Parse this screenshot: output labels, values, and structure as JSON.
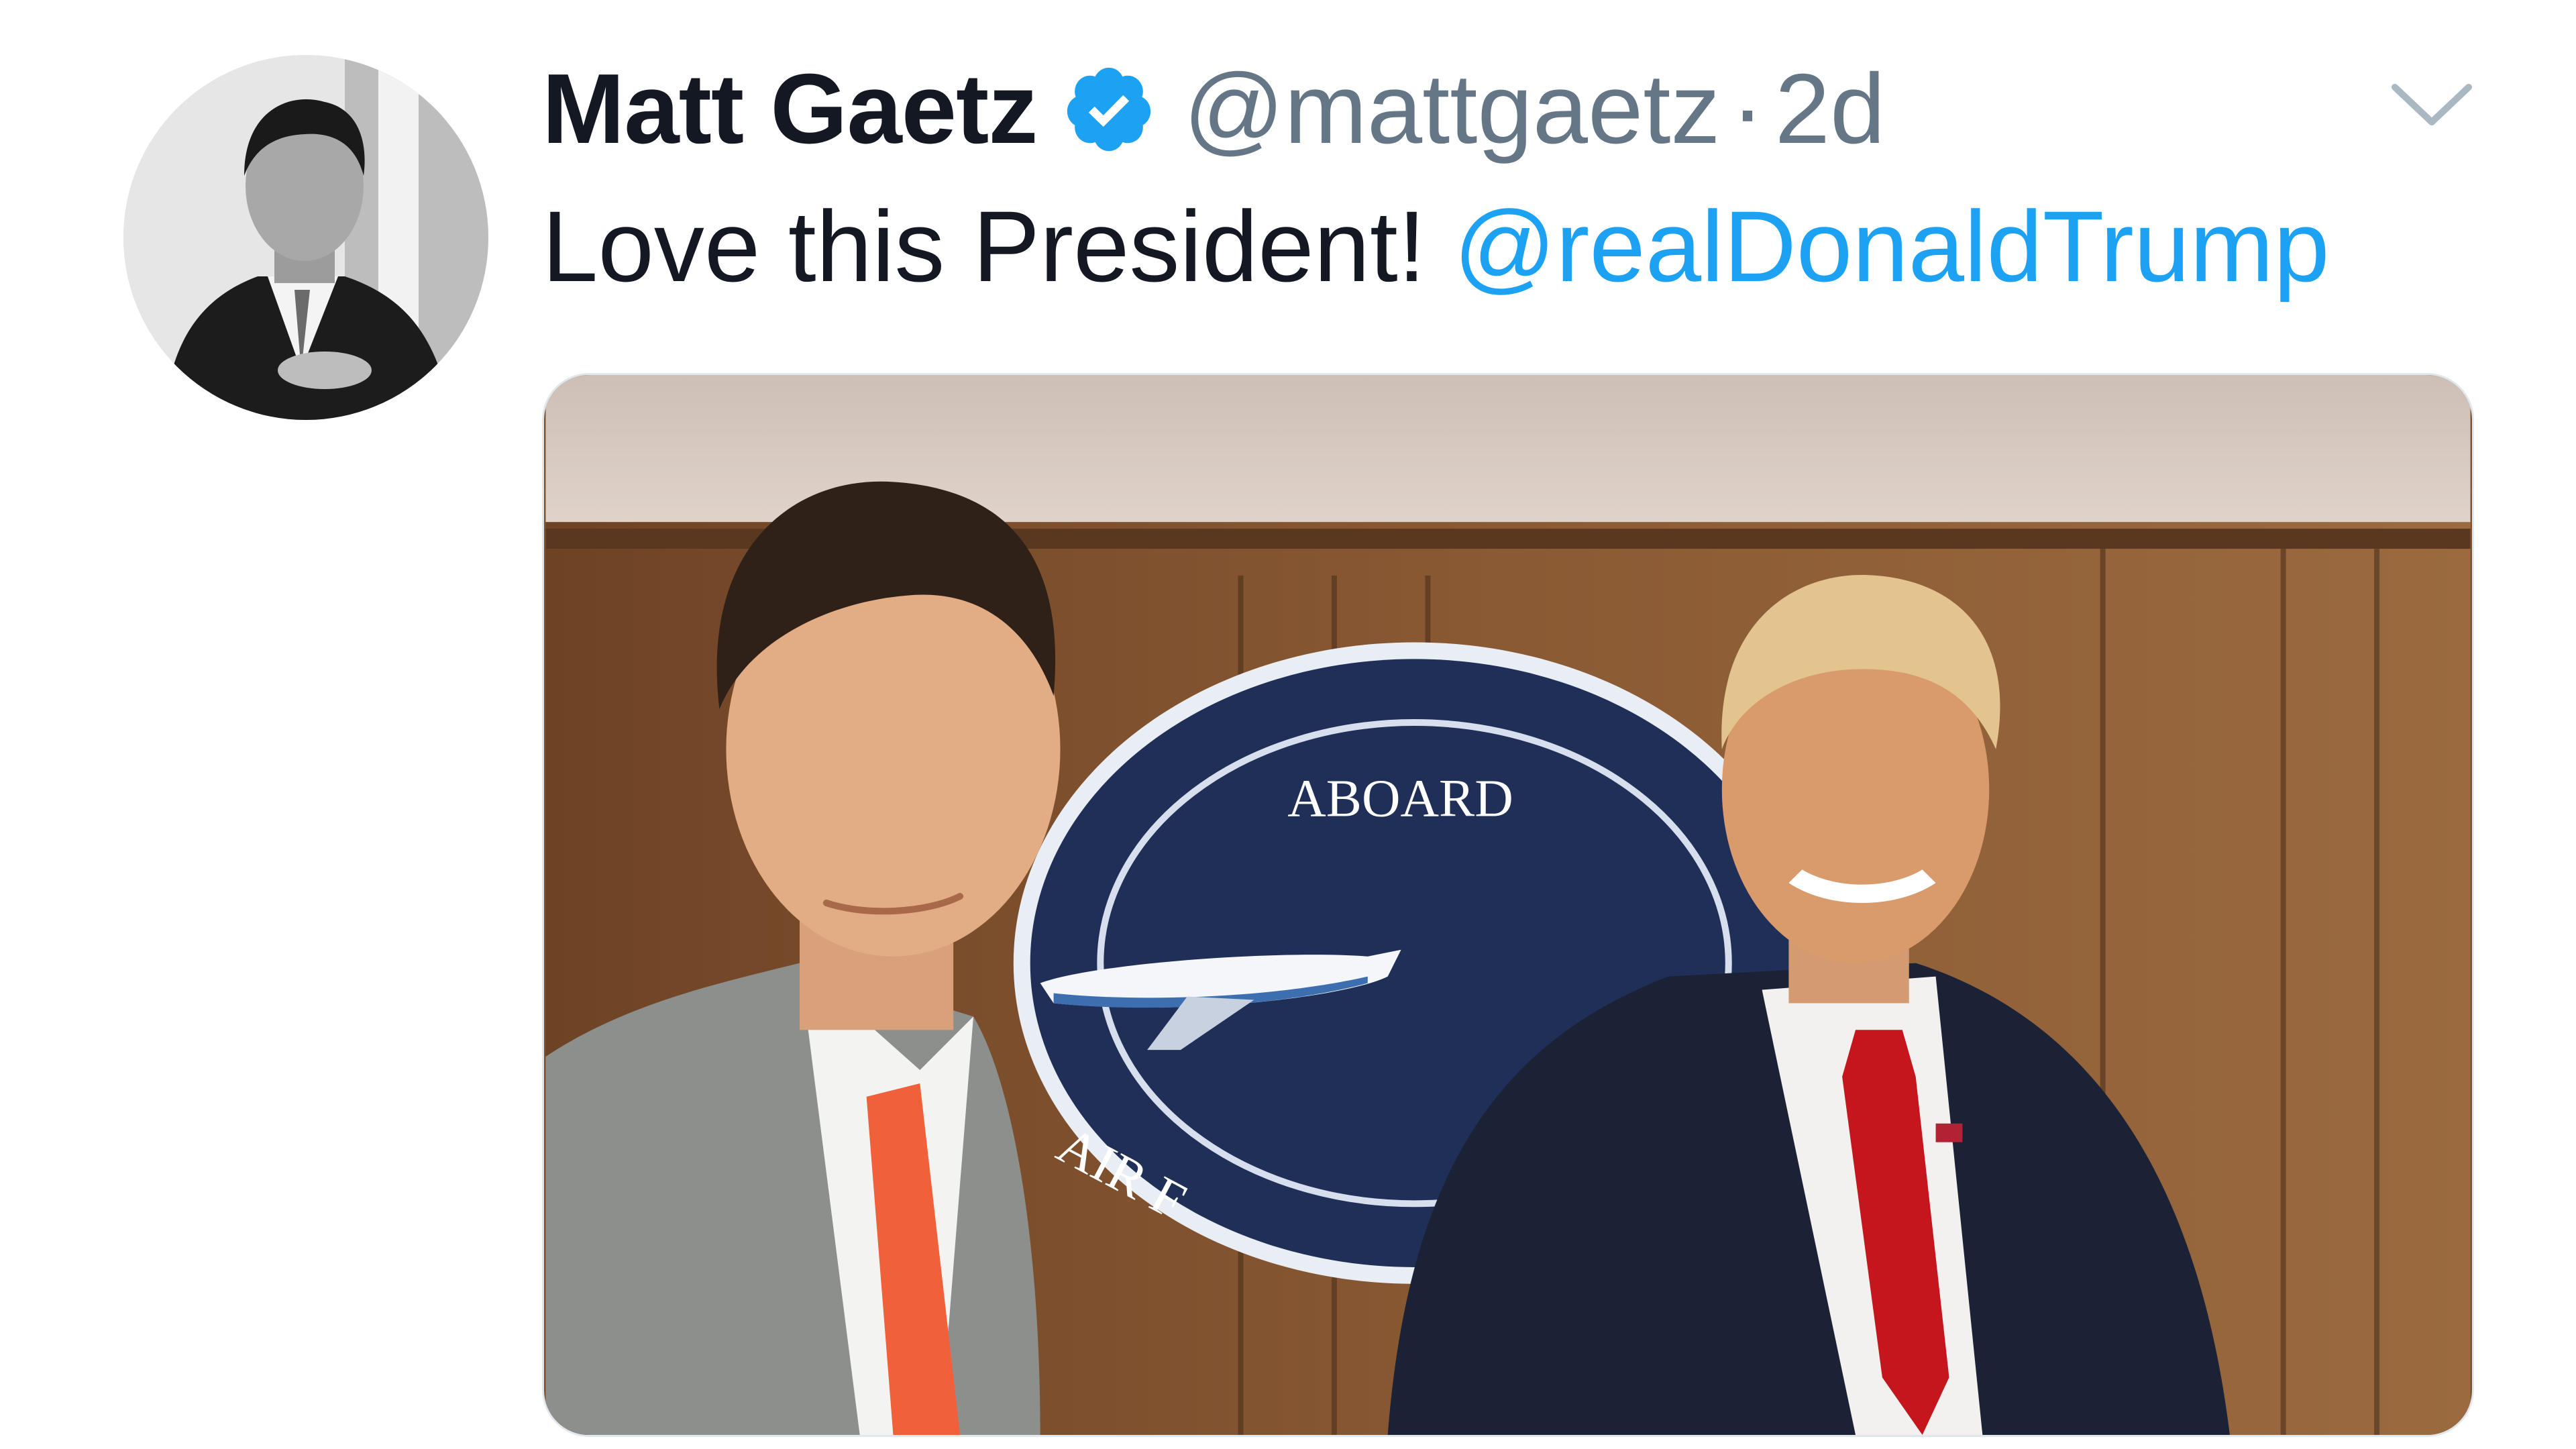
{
  "tweet": {
    "author_name": "Matt Gaetz",
    "handle": "@mattgaetz",
    "separator": "·",
    "time_ago": "2d",
    "text": "Love this President!",
    "mention": "@realDonaldTrump",
    "verified": true,
    "photo": {
      "seal_text_top": "ABOARD",
      "seal_text_bottom": "AIR F"
    }
  },
  "colors": {
    "text": "#141823",
    "secondary": "#657786",
    "link": "#1da1f2",
    "verified": "#1da1f2"
  },
  "icons": {
    "verified": "verified-badge-icon",
    "caret": "chevron-down-icon"
  }
}
